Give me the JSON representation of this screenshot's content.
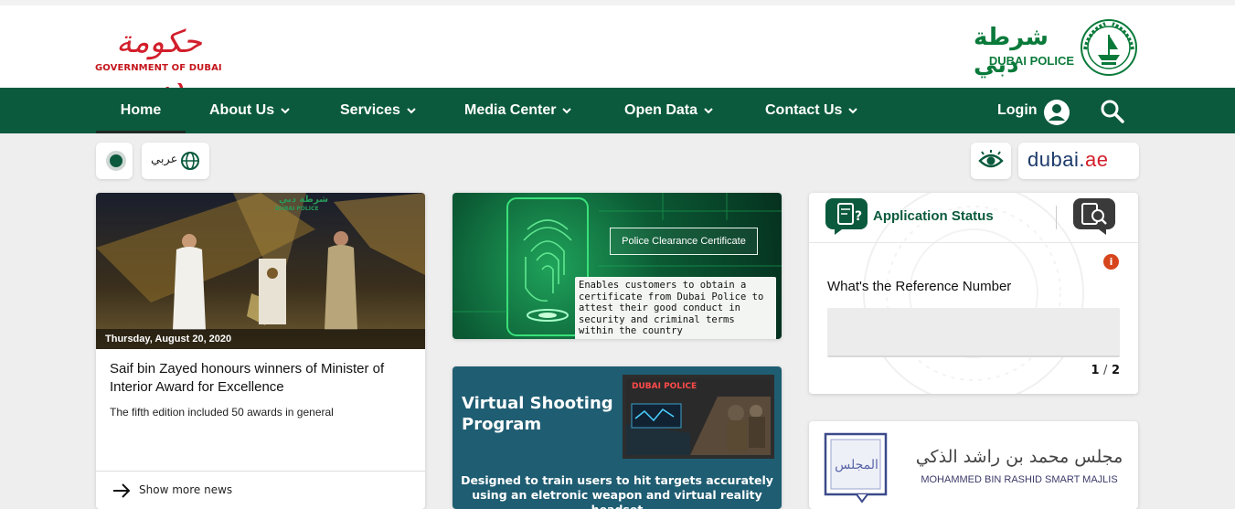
{
  "header": {
    "gov_logo_arabic": "حكومة دبي",
    "gov_logo_english": "GOVERNMENT OF DUBAI",
    "police_logo_arabic": "شرطة دبي",
    "police_logo_english": "DUBAI POLICE"
  },
  "nav": {
    "items": [
      {
        "label": "Home",
        "icon": null
      },
      {
        "label": "About Us",
        "icon": "chevron-down-icon"
      },
      {
        "label": "Services",
        "icon": "chevron-down-icon"
      },
      {
        "label": "Media Center",
        "icon": "chevron-down-icon"
      },
      {
        "label": "Open Data",
        "icon": "chevron-down-icon"
      },
      {
        "label": "Contact Us",
        "icon": "chevron-down-icon"
      }
    ],
    "login_label": "Login",
    "active_color": "#0b5a3d"
  },
  "tools": {
    "language_label": "عربي",
    "dubai_ae_prefix": "dubai.",
    "dubai_ae_suffix": "ae"
  },
  "news": {
    "date": "Thursday, August 20, 2020",
    "image_overlay_arabic": "شرطة دبي",
    "image_overlay_english": "DUBAI POLICE",
    "title": "Saif bin Zayed honours winners of Minister of Interior Award for Excellence",
    "subtitle": "The fifth edition included 50 awards in general",
    "show_more": "Show more news"
  },
  "police_clearance": {
    "label": "Police Clearance Certificate",
    "description": "Enables customers to obtain a certificate from Dubai Police to attest their good conduct in security and criminal terms within the country"
  },
  "virtual_shooting": {
    "title": "Virtual Shooting Program",
    "screen_label": "DUBAI POLICE",
    "description": "Designed to train users to hit targets accurately using an eletronic weapon and virtual reality headset"
  },
  "application_status": {
    "title": "Application Status",
    "info_badge": "i",
    "reference_label": "What's the Reference Number",
    "reference_value": "",
    "pager_current": "1",
    "pager_separator": "/",
    "pager_total": "2"
  },
  "majlis": {
    "logo_text": "المجلس",
    "arabic": "مجلس محمد بن راشد الذكي",
    "english": "MOHAMMED BIN RASHID SMART MAJLIS"
  },
  "colors": {
    "brand_green": "#0b5a3d",
    "logo_green": "#0a7a3a",
    "gov_red": "#d21f2b",
    "info_orange": "#d6451b"
  }
}
